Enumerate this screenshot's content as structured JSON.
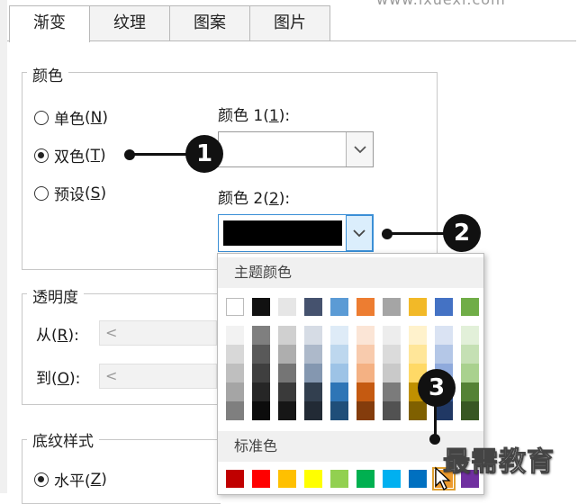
{
  "watermark_top": "www.ixuexi.com",
  "tabs": [
    {
      "label": "渐变",
      "active": true
    },
    {
      "label": "纹理",
      "active": false
    },
    {
      "label": "图案",
      "active": false
    },
    {
      "label": "图片",
      "active": false
    }
  ],
  "color_group": {
    "title": "颜色",
    "options": [
      {
        "label": "单色",
        "key": "N",
        "checked": false
      },
      {
        "label": "双色",
        "key": "T",
        "checked": true
      },
      {
        "label": "预设",
        "key": "S",
        "checked": false
      }
    ],
    "color1_label": "颜色 1(",
    "color1_key": "1",
    "color1_suffix": "):",
    "color2_label": "颜色 2(",
    "color2_key": "2",
    "color2_suffix": "):",
    "color1_value": "#ffffff",
    "color2_value": "#000000"
  },
  "transparency_group": {
    "title": "透明度",
    "from_label": "从(",
    "from_key": "R",
    "from_suffix": "):",
    "to_label": "到(",
    "to_key": "O",
    "to_suffix": "):",
    "arrow": "<"
  },
  "shading_group": {
    "title": "底纹样式",
    "horizontal_label": "水平(",
    "horizontal_key": "Z",
    "horizontal_suffix": ")",
    "checked": true
  },
  "color_popup": {
    "theme_header": "主题颜色",
    "standard_header": "标准色",
    "theme_colors": [
      "#ffffff",
      "#111111",
      "#e6e6e6",
      "#45526e",
      "#5b9bd5",
      "#ed7d31",
      "#a5a5a5",
      "#f2b928",
      "#4472c4",
      "#70ad47"
    ],
    "theme_shades": [
      [
        "#f2f2f2",
        "#d8d8d8",
        "#bfbfbf",
        "#a5a5a5",
        "#7f7f7f"
      ],
      [
        "#7f7f7f",
        "#595959",
        "#3f3f3f",
        "#262626",
        "#0c0c0c"
      ],
      [
        "#d0d0d0",
        "#aeaeae",
        "#757575",
        "#3a3a3a",
        "#161616"
      ],
      [
        "#d6dce5",
        "#adb9ca",
        "#8497b0",
        "#323f4f",
        "#222a35"
      ],
      [
        "#deebf7",
        "#bdd7ee",
        "#9dc3e6",
        "#2e75b6",
        "#1f4e79"
      ],
      [
        "#fbe5d6",
        "#f8cbad",
        "#f4b183",
        "#c55a11",
        "#843c0c"
      ],
      [
        "#ededed",
        "#dbdbdb",
        "#c9c9c9",
        "#7b7b7b",
        "#525252"
      ],
      [
        "#fff2cc",
        "#ffe699",
        "#ffd966",
        "#bf9000",
        "#7f6000"
      ],
      [
        "#dae3f3",
        "#b4c7e7",
        "#8faadc",
        "#2f5597",
        "#203864"
      ],
      [
        "#e2f0d9",
        "#c5e0b4",
        "#a9d18e",
        "#548235",
        "#385723"
      ]
    ],
    "standard_colors": [
      "#c00000",
      "#ff0000",
      "#ffc000",
      "#ffff00",
      "#92d050",
      "#00b050",
      "#00b0f0",
      "#0070c0",
      "#ed9b2e",
      "#7030a0"
    ]
  },
  "callouts": [
    "1",
    "2",
    "3"
  ],
  "watermark": "最需教育"
}
